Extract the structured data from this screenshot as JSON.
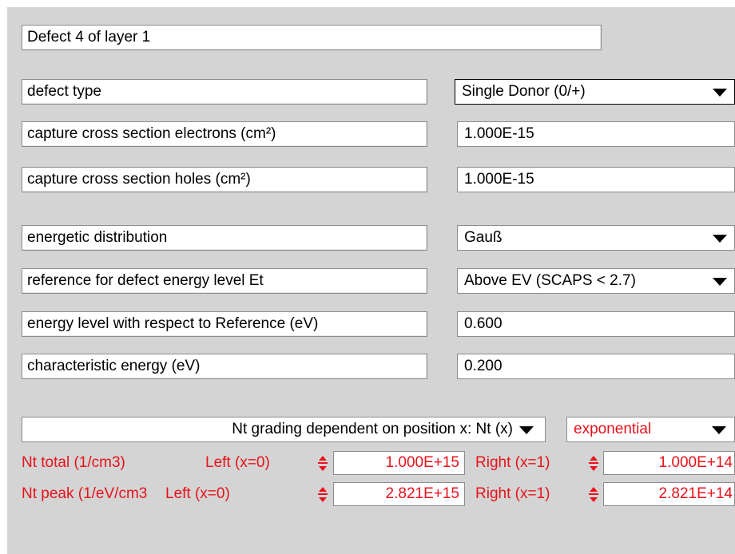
{
  "title": "Defect 4 of layer 1",
  "rows": [
    {
      "label": "defect type",
      "value": "Single Donor (0/+)"
    },
    {
      "label": "capture cross section electrons (cm²)",
      "value": "1.000E-15"
    },
    {
      "label": "capture cross section holes (cm²)",
      "value": "1.000E-15"
    },
    {
      "label": "energetic distribution",
      "value": "Gauß"
    },
    {
      "label": "reference for defect energy level Et",
      "value": "Above EV (SCAPS < 2.7)"
    },
    {
      "label": "energy level with respect to Reference (eV)",
      "value": "0.600"
    },
    {
      "label": "characteristic energy (eV)",
      "value": "0.200"
    }
  ],
  "grading": {
    "dependency": "Nt grading dependent on position x: Nt (x)",
    "profile": "exponential"
  },
  "nt_total": {
    "label": "Nt total (1/cm3)",
    "left_label": "Left (x=0)",
    "left_value": "1.000E+15",
    "right_label": "Right (x=1)",
    "right_value": "1.000E+14"
  },
  "nt_peak": {
    "label": "Nt peak (1/eV/cm3",
    "left_label": "Left (x=0)",
    "left_value": "2.821E+15",
    "right_label": "Right (x=1)",
    "right_value": "2.821E+14"
  },
  "colors": {
    "panel": "#d4d4d4",
    "accent_red": "#e8121b"
  }
}
